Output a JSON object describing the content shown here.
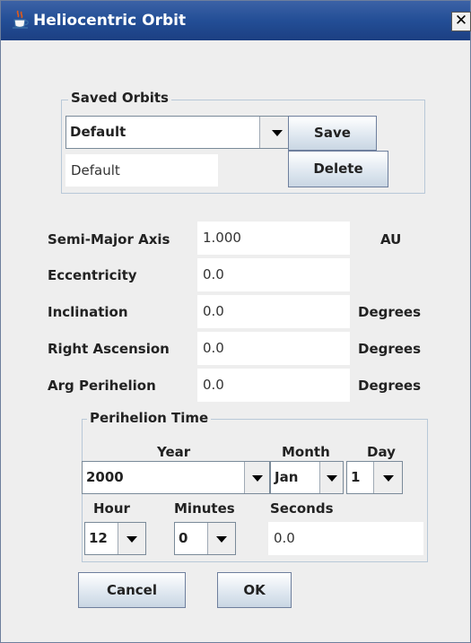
{
  "window": {
    "title": "Heliocentric Orbit",
    "icons": {
      "app": "java-cup-icon",
      "close": "close-icon"
    },
    "close_label": "✕"
  },
  "saved_orbits": {
    "group_label": "Saved Orbits",
    "selected": "Default",
    "save_label": "Save",
    "name_value": "Default",
    "delete_label": "Delete"
  },
  "elements": {
    "semi_major_axis": {
      "label": "Semi-Major Axis",
      "value": "1.000",
      "unit": "AU"
    },
    "eccentricity": {
      "label": "Eccentricity",
      "value": "0.0"
    },
    "inclination": {
      "label": "Inclination",
      "value": "0.0",
      "unit": "Degrees"
    },
    "right_ascension": {
      "label": "Right Ascension",
      "value": "0.0",
      "unit": "Degrees"
    },
    "arg_perihelion": {
      "label": "Arg Perihelion",
      "value": "0.0",
      "unit": "Degrees"
    }
  },
  "perihelion_time": {
    "group_label": "Perihelion Time",
    "year_label": "Year",
    "month_label": "Month",
    "day_label": "Day",
    "year": "2000",
    "month": "Jan",
    "day": "1",
    "hour_label": "Hour",
    "minutes_label": "Minutes",
    "seconds_label": "Seconds",
    "hour": "12",
    "minutes": "0",
    "seconds": "0.0"
  },
  "buttons": {
    "cancel": "Cancel",
    "ok": "OK"
  },
  "colors": {
    "titlebar": "#234e96",
    "background": "#eeeeee",
    "group_border": "#b8c8d8"
  }
}
